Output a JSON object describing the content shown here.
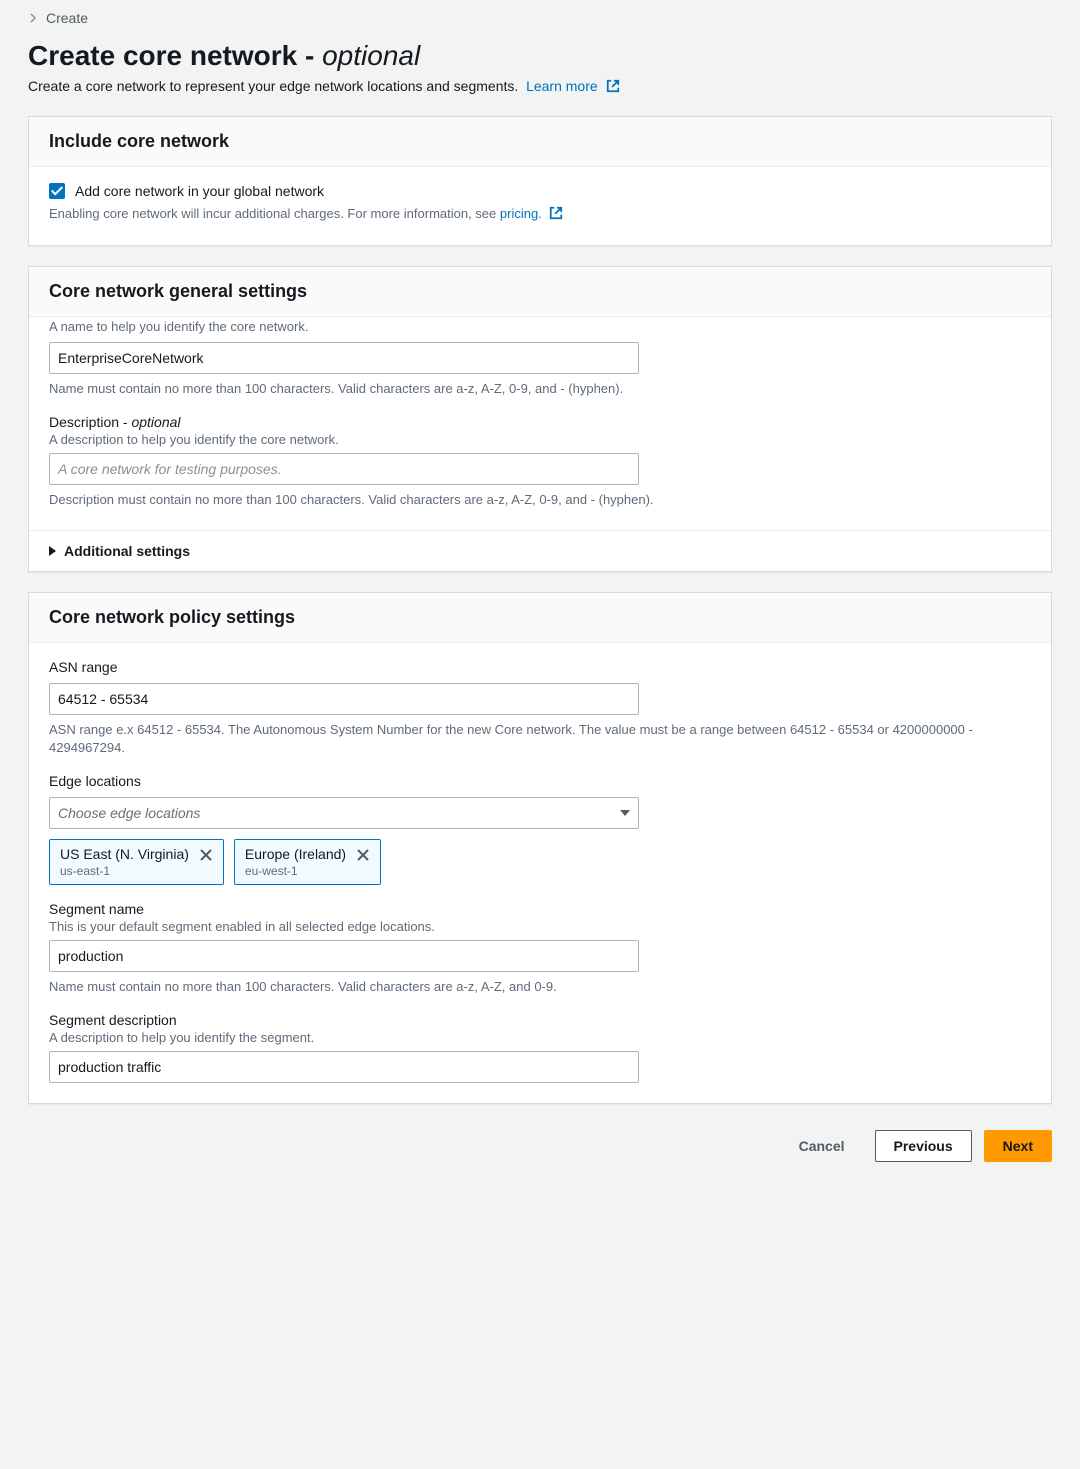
{
  "breadcrumb": {
    "current": "Create"
  },
  "title": {
    "main": "Create core network - ",
    "suffix": "optional"
  },
  "subtitle": {
    "text": "Create a core network to represent your edge network locations and segments.",
    "learn_more": "Learn more"
  },
  "include_panel": {
    "heading": "Include core network",
    "checkbox_label": "Add core network in your global network",
    "hint_prefix": "Enabling core network will incur additional charges. For more information, see ",
    "pricing_link": "pricing."
  },
  "general_panel": {
    "heading": "Core network general settings",
    "name_help_truncated": "A name to help you identify the core network.",
    "name_value": "EnterpriseCoreNetwork",
    "name_constraint": "Name must contain no more than 100 characters. Valid characters are a-z, A-Z, 0-9, and - (hyphen).",
    "desc_label": "Description - ",
    "desc_label_suffix": "optional",
    "desc_help": "A description to help you identify the core network.",
    "desc_placeholder": "A core network for testing purposes.",
    "desc_constraint": "Description must contain no more than 100 characters. Valid characters are a-z, A-Z, 0-9, and - (hyphen).",
    "additional_settings": "Additional settings"
  },
  "policy_panel": {
    "heading": "Core network policy settings",
    "asn_label": "ASN range",
    "asn_value": "64512 - 65534",
    "asn_constraint": "ASN range e.x 64512 - 65534. The Autonomous System Number for the new Core network. The value must be a range between 64512 - 65534 or 4200000000 - 4294967294.",
    "edge_label": "Edge locations",
    "edge_placeholder": "Choose edge locations",
    "edge_tokens": [
      {
        "label": "US East (N. Virginia)",
        "sub": "us-east-1"
      },
      {
        "label": "Europe (Ireland)",
        "sub": "eu-west-1"
      }
    ],
    "segment_name_label": "Segment name",
    "segment_name_help": "This is your default segment enabled in all selected edge locations.",
    "segment_name_value": "production",
    "segment_name_constraint": "Name must contain no more than 100 characters. Valid characters are a-z, A-Z, and 0-9.",
    "segment_desc_label": "Segment description",
    "segment_desc_help": "A description to help you identify the segment.",
    "segment_desc_value": "production traffic"
  },
  "footer": {
    "cancel": "Cancel",
    "previous": "Previous",
    "next": "Next"
  }
}
